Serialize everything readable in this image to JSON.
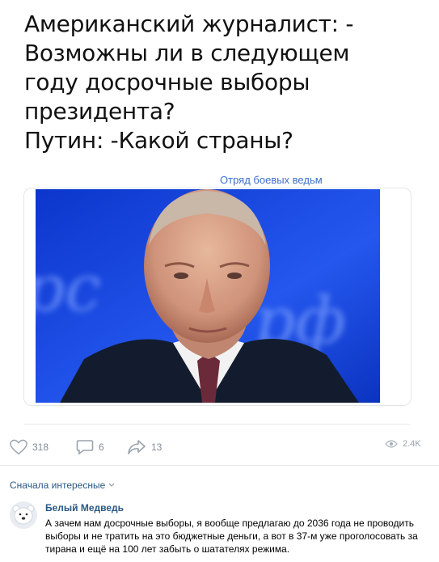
{
  "post": {
    "meme_lines": [
      "Американский журналист: -",
      "Возможны ли в следующем",
      "году досрочные выборы",
      "президента?",
      "Путин: -Какой страны?"
    ],
    "watermark": "Отряд боевых ведьм",
    "photo_backdrop_text": "рф"
  },
  "actions": {
    "likes": "318",
    "comments": "6",
    "reposts": "13",
    "views": "2.4K"
  },
  "comments_section": {
    "sort_label": "Сначала интересные",
    "items": [
      {
        "author": "Белый Медведь",
        "text": "А зачем нам досрочные выборы, я вообще предлагаю до 2036 года не проводить выборы и не тратить на это бюджетные деньги, а вот в 37-м уже проголосовать за тирана и ещё на 100 лет забыть о шатателях режима."
      }
    ]
  },
  "colors": {
    "link": "#2a5885",
    "muted": "#818c99",
    "watermark": "#3f6ecc",
    "photo_background": "#1a46e0"
  }
}
